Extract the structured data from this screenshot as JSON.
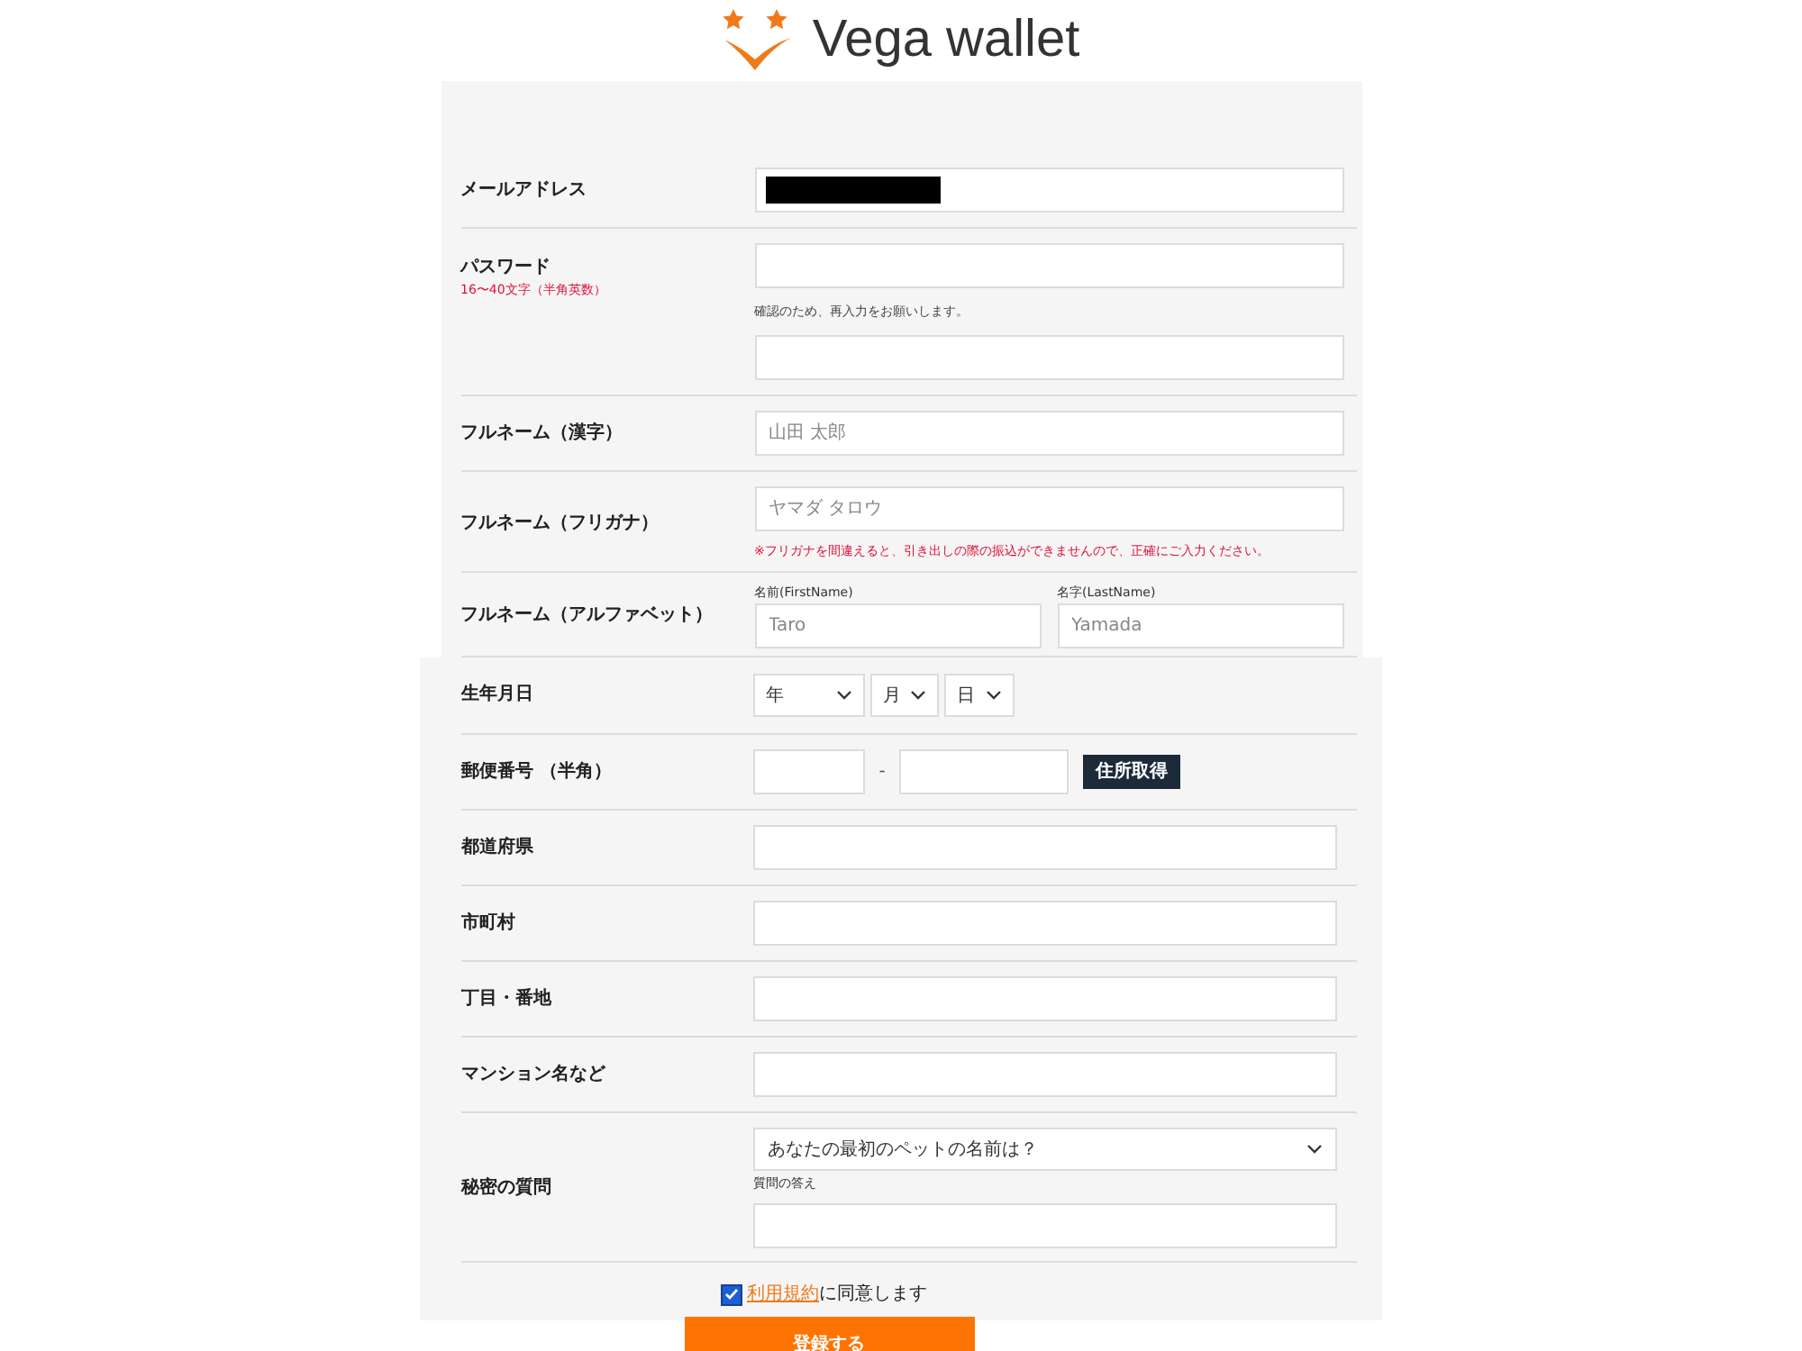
{
  "header": {
    "logo_text": "Vega wallet"
  },
  "form_top": {
    "rows": [
      {
        "kind": "text",
        "label": "メールアドレス",
        "redacted": true
      },
      {
        "kind": "password",
        "label": "パスワード",
        "note": "16〜40文字（半角英数）",
        "confirm_hint": "確認のため、再入力をお願いします。"
      },
      {
        "kind": "text",
        "label": "フルネーム（漢字）",
        "placeholder": "山田 太郎"
      },
      {
        "kind": "text",
        "label": "フルネーム（フリガナ）",
        "placeholder": "ヤマダ タロウ",
        "warning": "※フリガナを間違えると、引き出しの際の振込ができませんので、正確にご入力ください。"
      },
      {
        "kind": "name_pair",
        "label": "フルネーム（アルファベット）",
        "fields": [
          {
            "caption": "名前(FirstName)",
            "placeholder": "Taro"
          },
          {
            "caption": "名字(LastName)",
            "placeholder": "Yamada"
          }
        ]
      }
    ]
  },
  "form_bottom": {
    "rows": [
      {
        "kind": "date",
        "label": "生年月日",
        "selects": [
          "年",
          "月",
          "日"
        ]
      },
      {
        "kind": "postal",
        "label": "郵便番号 （半角）",
        "separator": "-",
        "button": "住所取得"
      },
      {
        "kind": "text",
        "label": "都道府県"
      },
      {
        "kind": "text",
        "label": "市町村"
      },
      {
        "kind": "text",
        "label": "丁目・番地"
      },
      {
        "kind": "text",
        "label": "マンション名など"
      },
      {
        "kind": "question",
        "label": "秘密の質問",
        "value": "あなたの最初のペットの名前は？",
        "answer_caption": "質問の答え"
      }
    ],
    "agreement": {
      "checked": true,
      "link": "利用規約",
      "text": "に同意します"
    }
  },
  "submit": "登録する"
}
